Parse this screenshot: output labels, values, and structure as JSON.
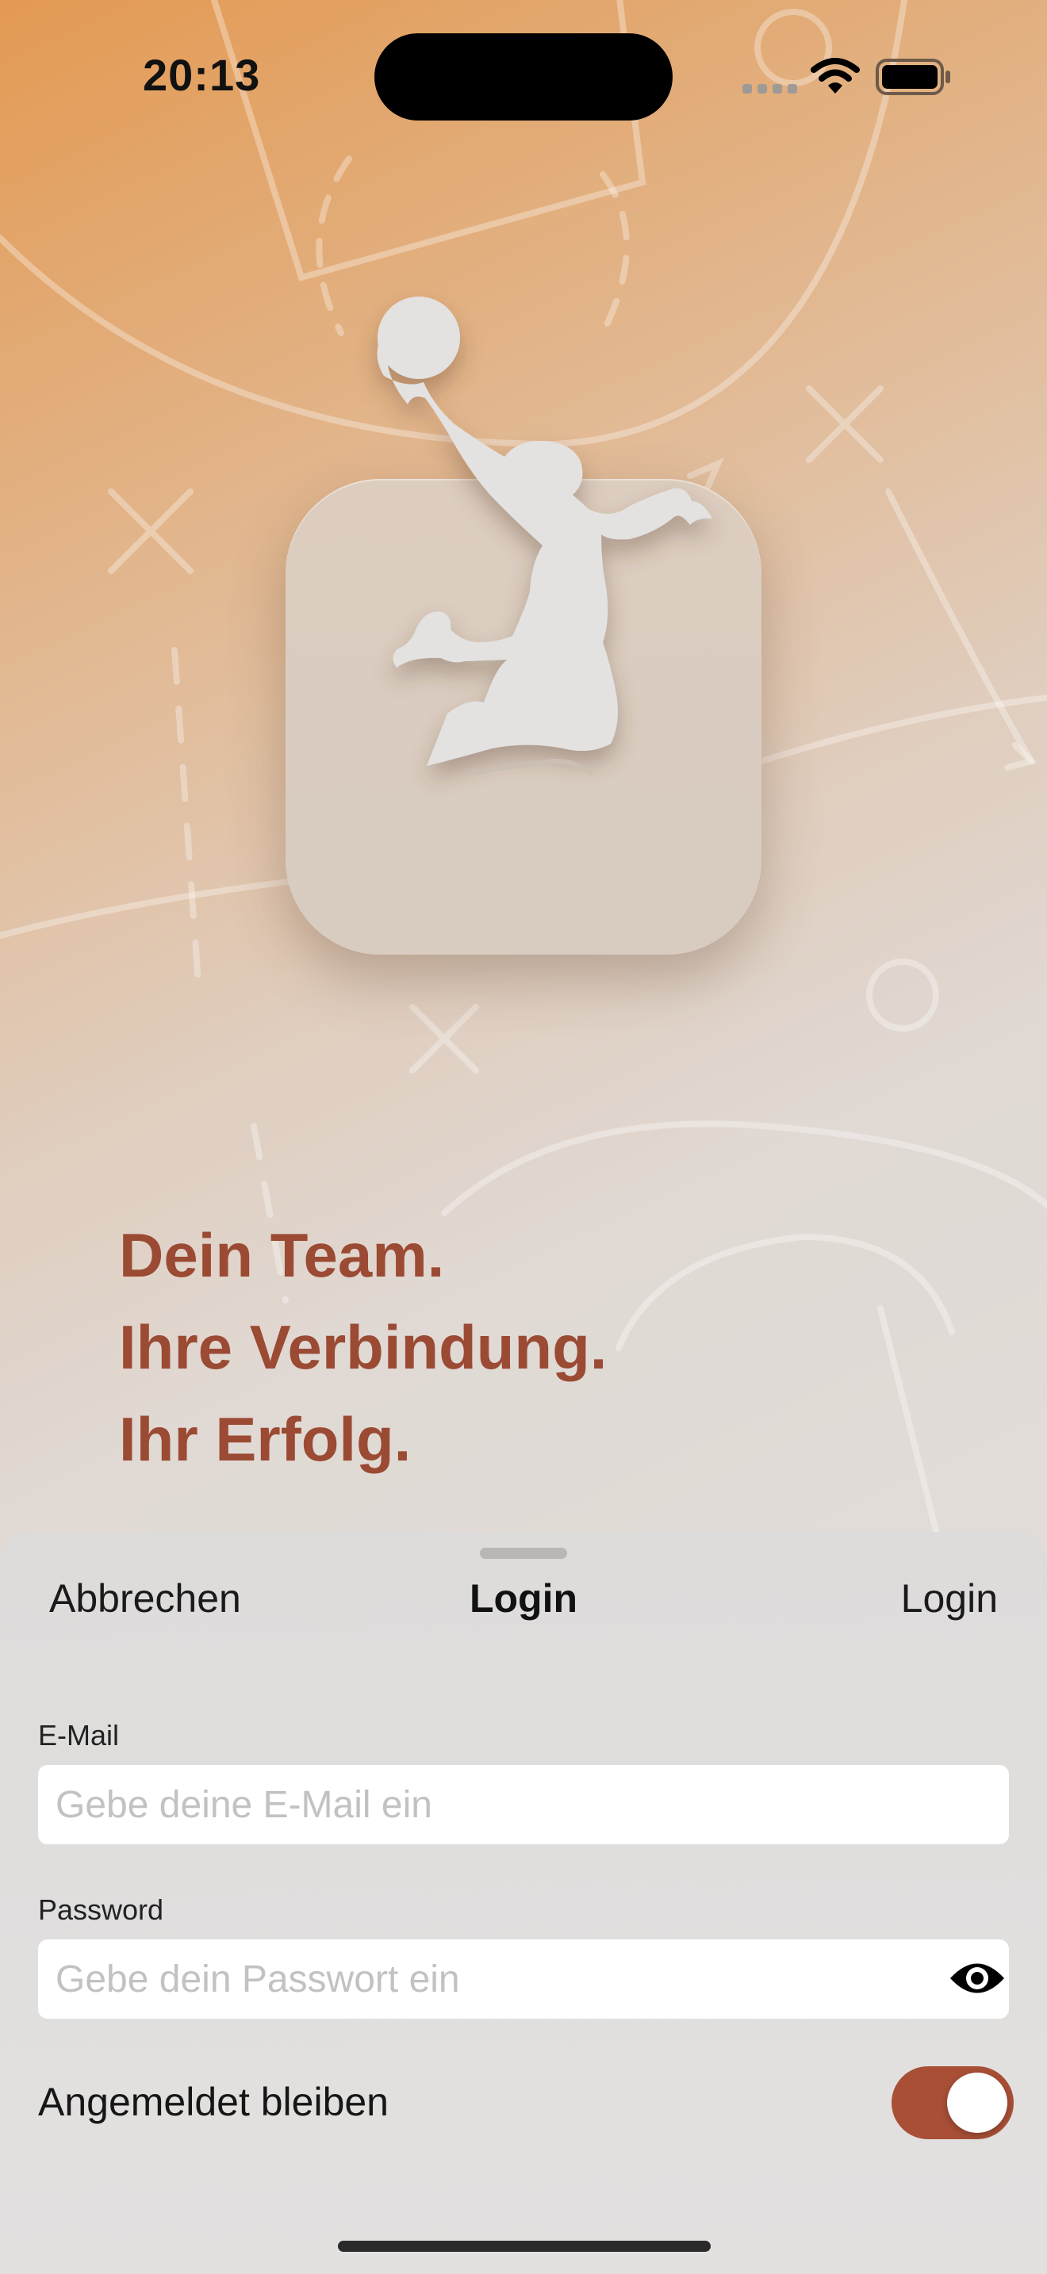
{
  "status_bar": {
    "time": "20:13",
    "icons": [
      "signal-icon",
      "wifi-icon",
      "battery-icon"
    ]
  },
  "branding": {
    "logo_icon": "basketball-player-dunk-icon",
    "tagline": [
      "Dein Team.",
      "Ihre Verbindung.",
      "Ihr Erfolg."
    ]
  },
  "sheet": {
    "cancel_label": "Abbrechen",
    "title": "Login",
    "submit_label": "Login",
    "email": {
      "label": "E-Mail",
      "value": "",
      "placeholder": "Gebe deine E-Mail ein"
    },
    "password": {
      "label": "Password",
      "value": "",
      "placeholder": "Gebe dein Passwort ein",
      "reveal_icon": "eye-icon"
    },
    "stay_logged_in": {
      "label": "Angemeldet bleiben",
      "on": true
    }
  },
  "colors": {
    "accent": "#a84f36",
    "tagline": "#9b4a33",
    "gradient_top": "#e39a53",
    "gradient_bottom": "#e3e1df"
  }
}
